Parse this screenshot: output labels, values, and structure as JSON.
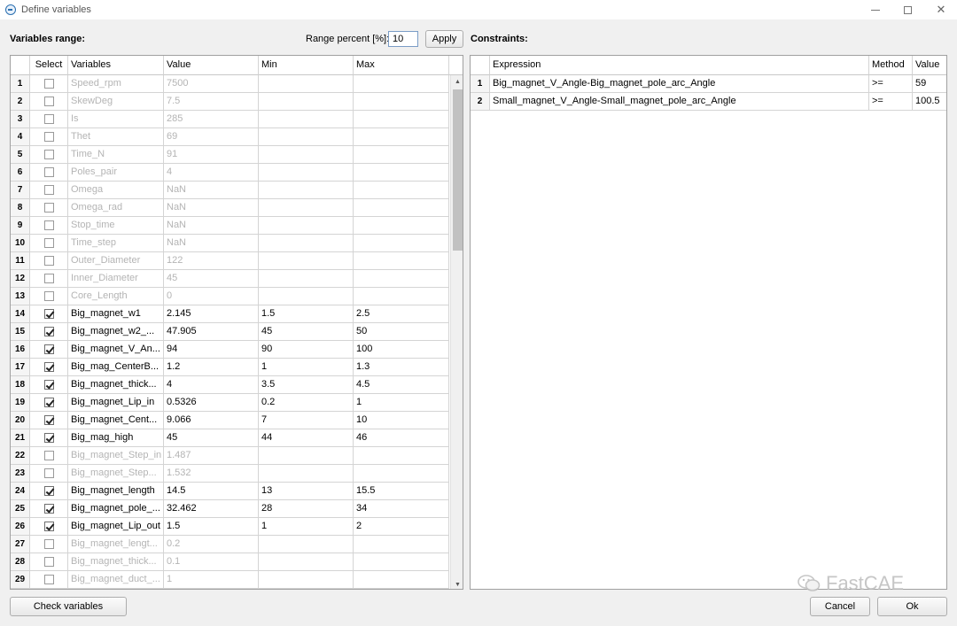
{
  "window": {
    "title": "Define variables"
  },
  "toolbar": {
    "variables_range_label": "Variables range:",
    "range_percent_label": "Range percent [%]:",
    "range_percent_value": "10",
    "apply_label": "Apply",
    "constraints_label": "Constraints:"
  },
  "variables_table": {
    "headers": {
      "select": "Select",
      "variables": "Variables",
      "value": "Value",
      "min": "Min",
      "max": "Max"
    },
    "rows": [
      {
        "num": "1",
        "checked": false,
        "name": "Speed_rpm",
        "value": "7500",
        "min": "",
        "max": ""
      },
      {
        "num": "2",
        "checked": false,
        "name": "SkewDeg",
        "value": "7.5",
        "min": "",
        "max": ""
      },
      {
        "num": "3",
        "checked": false,
        "name": "Is",
        "value": "285",
        "min": "",
        "max": ""
      },
      {
        "num": "4",
        "checked": false,
        "name": "Thet",
        "value": "69",
        "min": "",
        "max": ""
      },
      {
        "num": "5",
        "checked": false,
        "name": "Time_N",
        "value": "91",
        "min": "",
        "max": ""
      },
      {
        "num": "6",
        "checked": false,
        "name": "Poles_pair",
        "value": "4",
        "min": "",
        "max": ""
      },
      {
        "num": "7",
        "checked": false,
        "name": "Omega",
        "value": "NaN",
        "min": "",
        "max": ""
      },
      {
        "num": "8",
        "checked": false,
        "name": "Omega_rad",
        "value": "NaN",
        "min": "",
        "max": ""
      },
      {
        "num": "9",
        "checked": false,
        "name": "Stop_time",
        "value": "NaN",
        "min": "",
        "max": ""
      },
      {
        "num": "10",
        "checked": false,
        "name": "Time_step",
        "value": "NaN",
        "min": "",
        "max": ""
      },
      {
        "num": "11",
        "checked": false,
        "name": "Outer_Diameter",
        "value": "122",
        "min": "",
        "max": ""
      },
      {
        "num": "12",
        "checked": false,
        "name": "Inner_Diameter",
        "value": "45",
        "min": "",
        "max": ""
      },
      {
        "num": "13",
        "checked": false,
        "name": "Core_Length",
        "value": "0",
        "min": "",
        "max": ""
      },
      {
        "num": "14",
        "checked": true,
        "name": "Big_magnet_w1",
        "value": "2.145",
        "min": "1.5",
        "max": "2.5"
      },
      {
        "num": "15",
        "checked": true,
        "name": "Big_magnet_w2_...",
        "value": "47.905",
        "min": "45",
        "max": "50"
      },
      {
        "num": "16",
        "checked": true,
        "name": "Big_magnet_V_An...",
        "value": "94",
        "min": "90",
        "max": "100"
      },
      {
        "num": "17",
        "checked": true,
        "name": "Big_mag_CenterB...",
        "value": "1.2",
        "min": "1",
        "max": "1.3"
      },
      {
        "num": "18",
        "checked": true,
        "name": "Big_magnet_thick...",
        "value": "4",
        "min": "3.5",
        "max": "4.5"
      },
      {
        "num": "19",
        "checked": true,
        "name": "Big_magnet_Lip_in",
        "value": "0.5326",
        "min": "0.2",
        "max": "1"
      },
      {
        "num": "20",
        "checked": true,
        "name": "Big_magnet_Cent...",
        "value": "9.066",
        "min": "7",
        "max": "10"
      },
      {
        "num": "21",
        "checked": true,
        "name": "Big_mag_high",
        "value": "45",
        "min": "44",
        "max": "46"
      },
      {
        "num": "22",
        "checked": false,
        "name": "Big_magnet_Step_in",
        "value": "1.487",
        "min": "",
        "max": ""
      },
      {
        "num": "23",
        "checked": false,
        "name": "Big_magnet_Step...",
        "value": "1.532",
        "min": "",
        "max": ""
      },
      {
        "num": "24",
        "checked": true,
        "name": "Big_magnet_length",
        "value": "14.5",
        "min": "13",
        "max": "15.5"
      },
      {
        "num": "25",
        "checked": true,
        "name": "Big_magnet_pole_...",
        "value": "32.462",
        "min": "28",
        "max": "34"
      },
      {
        "num": "26",
        "checked": true,
        "name": "Big_magnet_Lip_out",
        "value": "1.5",
        "min": "1",
        "max": "2"
      },
      {
        "num": "27",
        "checked": false,
        "name": "Big_magnet_lengt...",
        "value": "0.2",
        "min": "",
        "max": ""
      },
      {
        "num": "28",
        "checked": false,
        "name": "Big_magnet_thick...",
        "value": "0.1",
        "min": "",
        "max": ""
      },
      {
        "num": "29",
        "checked": false,
        "name": "Big_magnet_duct_...",
        "value": "1",
        "min": "",
        "max": ""
      }
    ]
  },
  "constraints_table": {
    "headers": {
      "expression": "Expression",
      "method": "Method",
      "value": "Value"
    },
    "rows": [
      {
        "num": "1",
        "expression": "Big_magnet_V_Angle-Big_magnet_pole_arc_Angle",
        "method": ">=",
        "value": "59"
      },
      {
        "num": "2",
        "expression": "Small_magnet_V_Angle-Small_magnet_pole_arc_Angle",
        "method": ">=",
        "value": "100.5"
      }
    ]
  },
  "footer": {
    "check_variables_label": "Check variables",
    "cancel_label": "Cancel",
    "ok_label": "Ok"
  },
  "watermark": {
    "text": "FastCAE",
    "icon": "wechat-icon"
  },
  "colors": {
    "disabled_text": "#b4b4b4",
    "window_bg": "#f0f0f0"
  }
}
